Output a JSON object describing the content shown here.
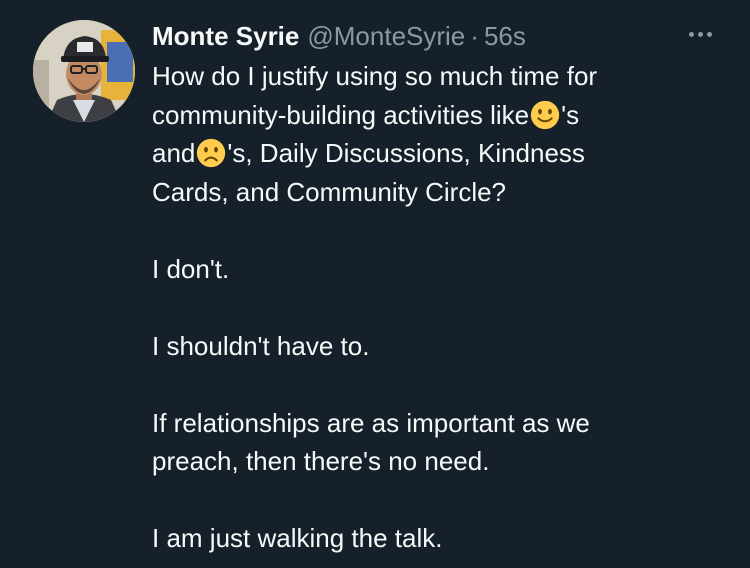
{
  "author": {
    "name": "Monte Syrie",
    "handle": "@MonteSyrie",
    "separator": "·",
    "time": "56s"
  },
  "avatar": {
    "icon": "profile-photo",
    "hat_text": "Coeur"
  },
  "more_icon": "more-horizontal-icon",
  "tweet": {
    "line1": "How do I justify using so much time for",
    "line2_a": "community-building activities like",
    "line2_b": "'s",
    "line3_a": "and",
    "line3_b": "'s, Daily Discussions, Kindness",
    "line4": "Cards, and Community Circle?",
    "line5": "I don't.",
    "line6": "I shouldn't have to.",
    "line7": "If relationships are as important as we",
    "line8": "preach, then there's no need.",
    "line9": "I am just walking the talk."
  },
  "emojis": {
    "smile": "slightly-smiling-face-icon",
    "frown": "slightly-frowning-face-icon"
  },
  "colors": {
    "background": "#15202b",
    "text": "#f7f9f9",
    "secondary": "#8b98a5",
    "emoji": "#ffcc4d"
  }
}
